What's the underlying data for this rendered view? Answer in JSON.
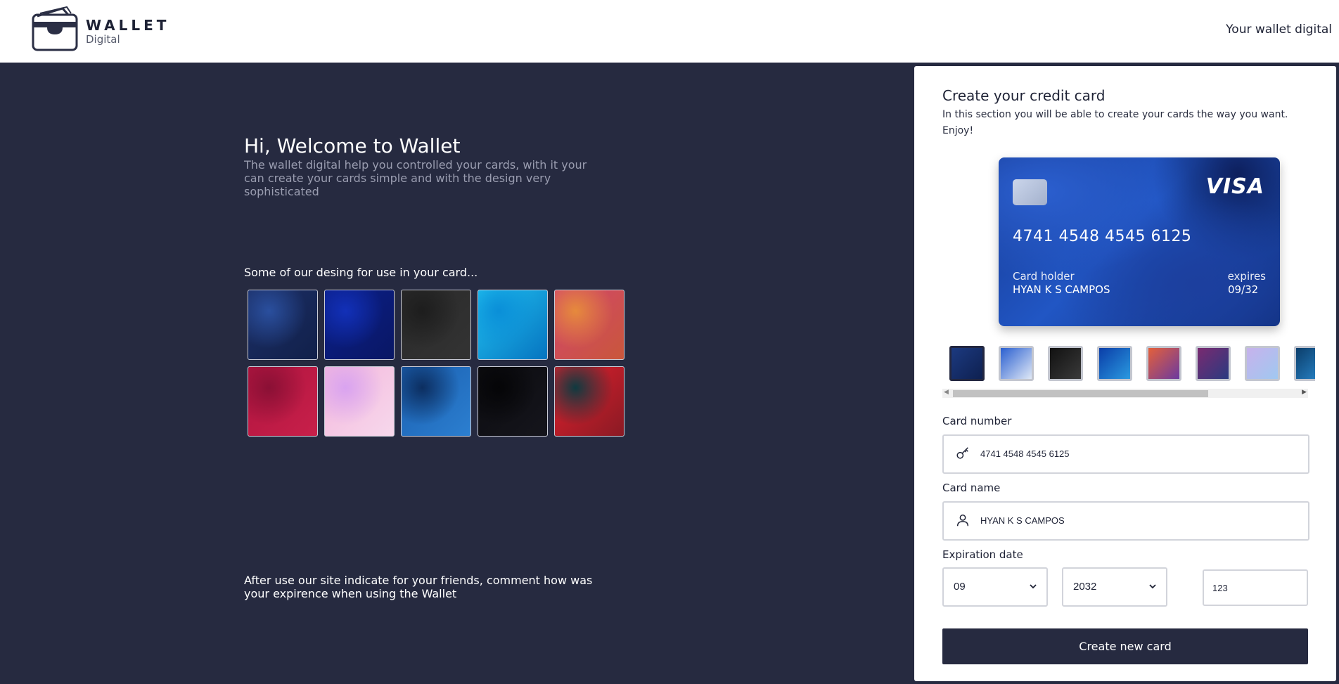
{
  "header": {
    "logo_title": "WALLET",
    "logo_subtitle": "Digital",
    "tagline": "Your wallet digital"
  },
  "intro": {
    "title": "Hi, Welcome to Wallet",
    "text": "The wallet digital help you controlled your cards, with it your can create your cards simple and with the design very sophisticated"
  },
  "designs": {
    "label": "Some of our desing for use in your card...",
    "items": [
      {
        "name": "dark-blue-fluid",
        "colors": [
          "#1c2f66",
          "#2a4f9e",
          "#11204a"
        ]
      },
      {
        "name": "navy-planet",
        "colors": [
          "#0b1f8a",
          "#1230b8",
          "#091764"
        ]
      },
      {
        "name": "black-texture",
        "colors": [
          "#2a2a2a",
          "#1d1d1d",
          "#333333"
        ]
      },
      {
        "name": "ocean-surface",
        "colors": [
          "#21c1f0",
          "#0a8fd8",
          "#0674c0"
        ]
      },
      {
        "name": "orange-pink-abstract",
        "colors": [
          "#d2456d",
          "#e68a3c",
          "#c9573b"
        ]
      },
      {
        "name": "crimson-waves",
        "colors": [
          "#b0143f",
          "#8a1035",
          "#c8204a"
        ]
      },
      {
        "name": "pink-marble",
        "colors": [
          "#f3b7dc",
          "#d9a3f0",
          "#f7d8ec"
        ]
      },
      {
        "name": "blue-fluid",
        "colors": [
          "#1a5fb0",
          "#0c2e60",
          "#2c7fd0"
        ]
      },
      {
        "name": "night-sky",
        "colors": [
          "#0c0c10",
          "#050507",
          "#15151c"
        ]
      },
      {
        "name": "red-teal-smoke",
        "colors": [
          "#e0202d",
          "#0f3a40",
          "#8a1a24"
        ]
      }
    ]
  },
  "footer": {
    "text": "After use our site indicate for your friends, comment how was your expirence when using the Wallet"
  },
  "panel": {
    "title": "Create your credit card",
    "description": "In this section you will be able to create your cards the way you want. Enjoy!",
    "card": {
      "brand": "VISA",
      "number": "4741 4548 4545 6125",
      "holder_label": "Card holder",
      "holder_name": "HYAN K S CAMPOS",
      "expires_label": "expires",
      "expires_value": "09/32"
    },
    "swatches": [
      {
        "name": "dark-blue",
        "colors": [
          "#1c3a80",
          "#0e2050"
        ],
        "active": true
      },
      {
        "name": "blue-white-swirl",
        "colors": [
          "#2a5fd0",
          "#dfe8f6"
        ]
      },
      {
        "name": "black-silk",
        "colors": [
          "#111",
          "#3a3a3a"
        ]
      },
      {
        "name": "deep-blue-glow",
        "colors": [
          "#0a3da8",
          "#2a9ae0"
        ]
      },
      {
        "name": "sunset-abstract",
        "colors": [
          "#e4603a",
          "#6b3aa0"
        ]
      },
      {
        "name": "purple-pink",
        "colors": [
          "#7a2a70",
          "#2a3a80"
        ]
      },
      {
        "name": "lilac-swirl",
        "colors": [
          "#c7b2ec",
          "#a0c8f0"
        ]
      },
      {
        "name": "teal-blue",
        "colors": [
          "#0b3d6a",
          "#2a8ad0"
        ]
      }
    ],
    "card_number_label": "Card number",
    "card_number_value": "4741 4548 4545 6125",
    "card_name_label": "Card name",
    "card_name_value": "HYAN K S CAMPOS",
    "expiration_label": "Expiration date",
    "month_value": "09",
    "year_value": "2032",
    "cvv_value": "123",
    "create_button": "Create new card"
  }
}
